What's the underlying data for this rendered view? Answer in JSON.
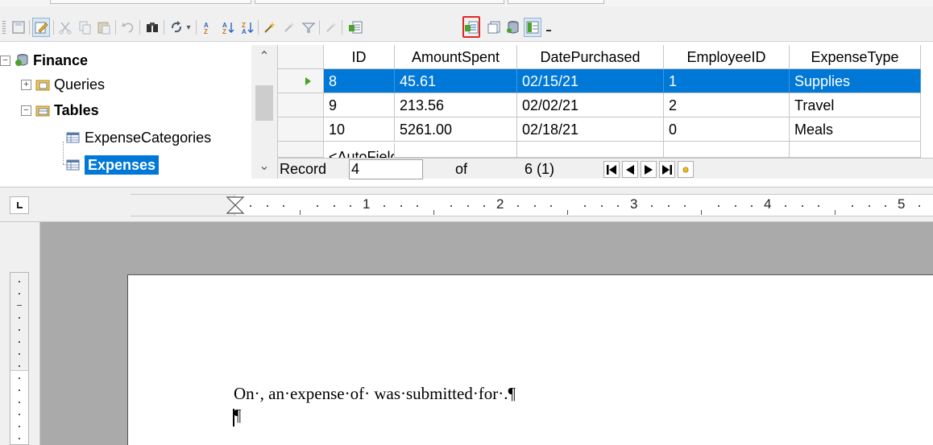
{
  "toolbar": {
    "buttons": [
      {
        "name": "save-record-icon"
      },
      {
        "name": "edit-data-icon"
      },
      {
        "name": "cut-icon"
      },
      {
        "name": "copy-icon"
      },
      {
        "name": "paste-icon"
      },
      {
        "name": "undo-icon"
      },
      {
        "name": "find-record-icon"
      },
      {
        "name": "refresh-icon"
      },
      {
        "name": "sort-ascending-icon"
      },
      {
        "name": "sort-icon"
      },
      {
        "name": "sort-descending-icon"
      },
      {
        "name": "autofilter-icon"
      },
      {
        "name": "standard-filter-icon"
      },
      {
        "name": "apply-filter-icon"
      },
      {
        "name": "remove-filter-icon"
      },
      {
        "name": "data-to-text-icon"
      },
      {
        "name": "data-to-fields-icon"
      },
      {
        "name": "mail-merge-icon"
      },
      {
        "name": "data-source-icon"
      },
      {
        "name": "explorer-icon"
      }
    ],
    "highlighted_button": "data-to-fields-icon"
  },
  "tree": {
    "items": [
      {
        "label": "Finance",
        "toggle": "−"
      },
      {
        "label": "Queries",
        "toggle": "+"
      },
      {
        "label": "Tables",
        "toggle": "−"
      },
      {
        "label": "ExpenseCategories"
      },
      {
        "label": "Expenses"
      }
    ],
    "scroll_up": "⌃",
    "scroll_down": "⌄"
  },
  "grid": {
    "columns": [
      "ID",
      "AmountSpent",
      "DatePurchased",
      "EmployeeID",
      "ExpenseType"
    ],
    "rows": [
      {
        "ID": "8",
        "AmountSpent": "45.61",
        "DatePurchased": "02/15/21",
        "EmployeeID": "1",
        "ExpenseType": "Supplies"
      },
      {
        "ID": "9",
        "AmountSpent": "213.56",
        "DatePurchased": "02/02/21",
        "EmployeeID": "2",
        "ExpenseType": "Travel"
      },
      {
        "ID": "10",
        "AmountSpent": "5261.00",
        "DatePurchased": "02/18/21",
        "EmployeeID": "0",
        "ExpenseType": "Meals"
      }
    ],
    "new_row_placeholder": "<AutoField>",
    "navigation": {
      "record_label": "Record",
      "record_value": "4",
      "of_label": "of",
      "total": "6 (1)"
    }
  },
  "ruler": {
    "numbers": [
      "1",
      "2",
      "3",
      "4",
      "5"
    ]
  },
  "document": {
    "line1": "On·, an·expense·of· was·submitted·for·.¶",
    "line2": "¶"
  },
  "colors": {
    "selection": "#0078d7",
    "highlight_border": "#e02828"
  }
}
